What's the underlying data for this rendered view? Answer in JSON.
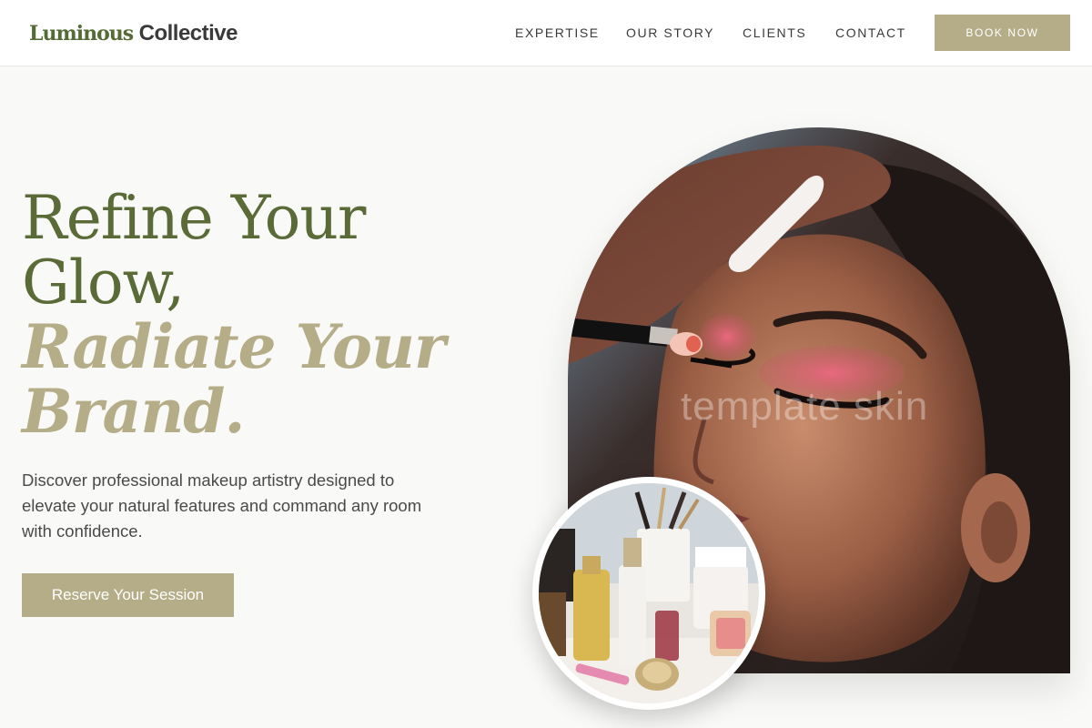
{
  "brand": {
    "name_part1": "Luminous",
    "name_part2": "Collective"
  },
  "nav": {
    "items": [
      {
        "label": "EXPERTISE"
      },
      {
        "label": "OUR STORY"
      },
      {
        "label": "CLIENTS"
      },
      {
        "label": "CONTACT"
      }
    ],
    "book_label": "BOOK NOW"
  },
  "hero": {
    "headline_line1": "Refine Your",
    "headline_line2": "Glow,",
    "headline_line3": "Radiate Your",
    "headline_line4": "Brand.",
    "description": "Discover professional makeup artistry designed to elevate your natural features and command any room with confidence.",
    "cta_label": "Reserve Your Session"
  },
  "media": {
    "watermark": "template skin"
  },
  "colors": {
    "accent_gold": "#b5ad88",
    "accent_green": "#5a6b38",
    "background": "#f9f9f7"
  }
}
